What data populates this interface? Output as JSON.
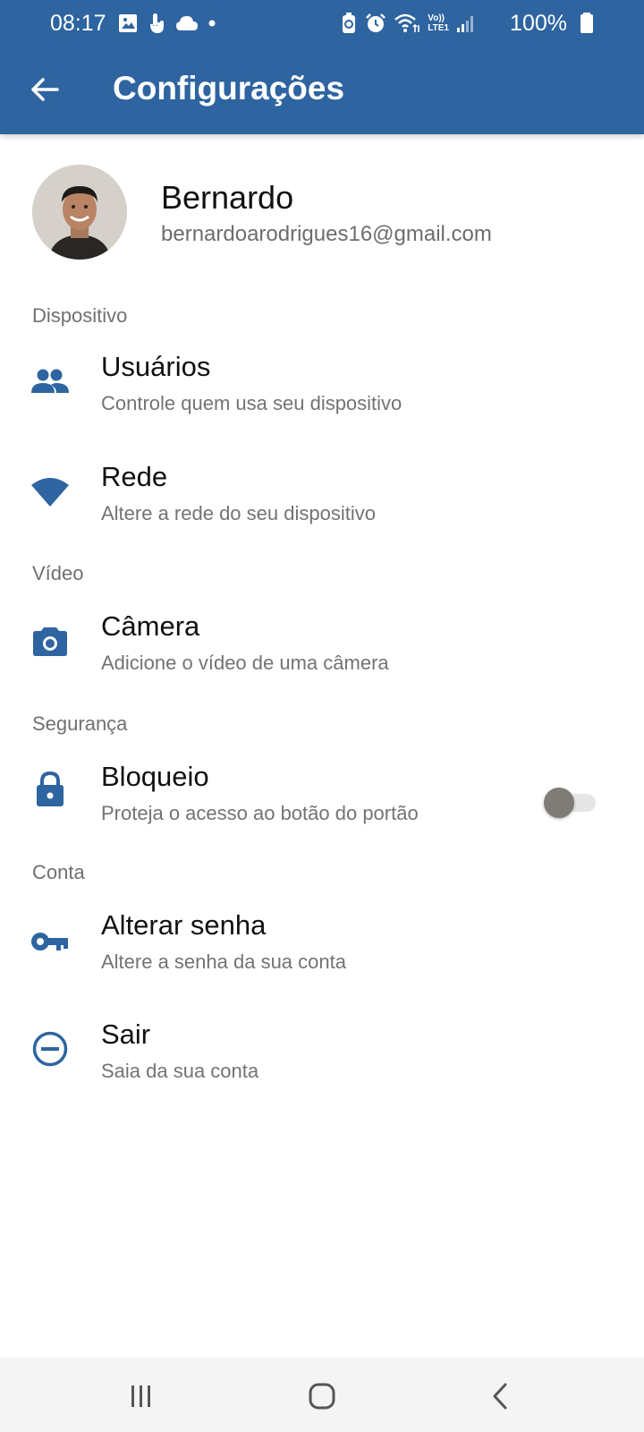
{
  "status_bar": {
    "time": "08:17",
    "battery": "100%",
    "network_label_top": "Vo))",
    "network_label_bottom": "LTE1"
  },
  "app_bar": {
    "title": "Configurações",
    "back_icon": "arrow-back-icon"
  },
  "profile": {
    "name": "Bernardo",
    "email": "bernardoarodrigues16@gmail.com"
  },
  "sections": {
    "device": {
      "header": "Dispositivo",
      "users": {
        "title": "Usuários",
        "subtitle": "Controle quem usa seu dispositivo",
        "icon": "people-icon"
      },
      "network": {
        "title": "Rede",
        "subtitle": "Altere a rede do seu dispositivo",
        "icon": "wifi-icon"
      }
    },
    "video": {
      "header": "Vídeo",
      "camera": {
        "title": "Câmera",
        "subtitle": "Adicione o vídeo de uma câmera",
        "icon": "camera-icon"
      }
    },
    "security": {
      "header": "Segurança",
      "lock": {
        "title": "Bloqueio",
        "subtitle": "Proteja o acesso ao botão do portão",
        "icon": "lock-icon",
        "enabled": false
      }
    },
    "account": {
      "header": "Conta",
      "password": {
        "title": "Alterar senha",
        "subtitle": "Altere a senha da sua conta",
        "icon": "key-icon"
      },
      "logout": {
        "title": "Sair",
        "subtitle": "Saia da sua conta",
        "icon": "minus-circle-icon"
      }
    }
  },
  "colors": {
    "primary": "#2e65a0",
    "icon": "#2e65a0",
    "subtitle": "#737373",
    "toggle_off_thumb": "#7f7b77"
  },
  "nav_bar": {
    "recents_icon": "recents-icon",
    "home_icon": "home-icon",
    "back_icon": "nav-back-icon"
  }
}
